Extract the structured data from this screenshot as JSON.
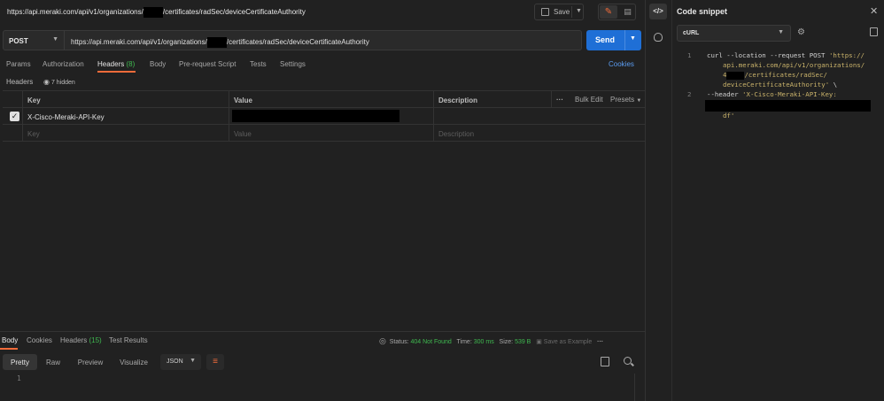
{
  "tab_title": {
    "prefix": "https://api.meraki.com/api/v1/organizations/",
    "suffix": "/certificates/radSec/deviceCertificateAuthority"
  },
  "toolbar": {
    "save_label": "Save"
  },
  "request": {
    "method": "POST",
    "url_prefix": "https://api.meraki.com/api/v1/organizations/",
    "url_suffix": "/certificates/radSec/deviceCertificateAuthority",
    "send_label": "Send"
  },
  "request_tabs": [
    {
      "label": "Params"
    },
    {
      "label": "Authorization"
    },
    {
      "label": "Headers",
      "count": "(8)"
    },
    {
      "label": "Body"
    },
    {
      "label": "Pre-request Script"
    },
    {
      "label": "Tests"
    },
    {
      "label": "Settings"
    }
  ],
  "cookies_label": "Cookies",
  "headers_section": {
    "title": "Headers",
    "hidden_label": "7 hidden"
  },
  "headers_table": {
    "columns": {
      "key": "Key",
      "value": "Value",
      "description": "Description"
    },
    "more_icon": "···",
    "bulk_edit": "Bulk Edit",
    "presets": "Presets",
    "rows": [
      {
        "key": "X-Cisco-Meraki-API-Key",
        "checked": true
      }
    ],
    "placeholder": {
      "key": "Key",
      "value": "Value",
      "description": "Description"
    }
  },
  "response_tabs": [
    {
      "label": "Body"
    },
    {
      "label": "Cookies"
    },
    {
      "label": "Headers",
      "count": "(15)"
    },
    {
      "label": "Test Results"
    }
  ],
  "response_status": {
    "status_label": "Status:",
    "status_value": "404 Not Found",
    "time_label": "Time:",
    "time_value": "300 ms",
    "size_label": "Size:",
    "size_value": "539 B",
    "save_example": "Save as Example"
  },
  "response_view": {
    "modes": [
      "Pretty",
      "Raw",
      "Preview",
      "Visualize"
    ],
    "format": "JSON",
    "line_number": "1"
  },
  "code_snippet": {
    "title": "Code snippet",
    "language": "cURL",
    "line_numbers": [
      "1",
      "2"
    ],
    "lines": {
      "l1": "curl --location --request POST ",
      "l1_str": "'https://",
      "l2": "api.meraki.com/api/v1/organizations/",
      "l3_pre": "4",
      "l3_post": "/certificates/radSec/",
      "l4": "deviceCertificateAuthority'",
      "l4_tail": " \\",
      "l5": "--header ",
      "l5_str": "'X-Cisco-Meraki-API-Key:",
      "l7": "df'"
    }
  },
  "colors": {
    "accent": "#f26b3a",
    "primary": "#1f6fd6",
    "status_ok": "#3fb950",
    "background": "#212121"
  }
}
